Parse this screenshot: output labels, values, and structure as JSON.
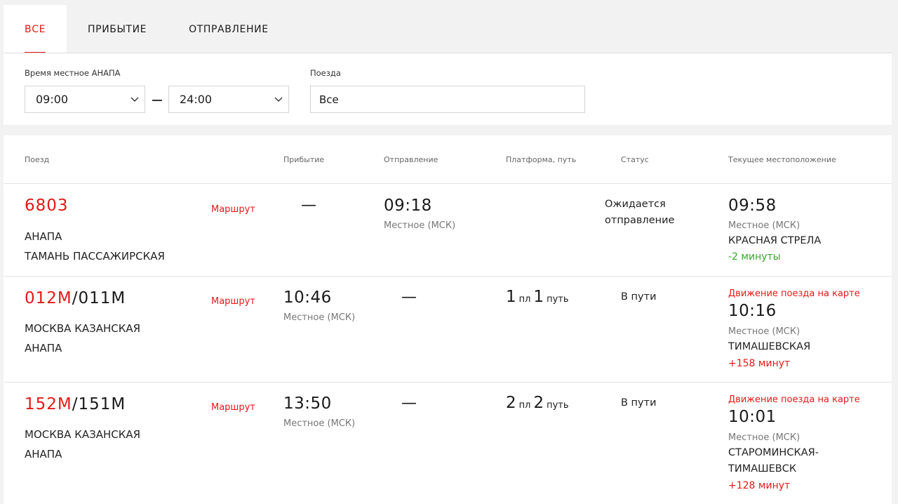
{
  "tabs": [
    {
      "label": "ВСЕ",
      "active": true
    },
    {
      "label": "ПРИБЫТИЕ",
      "active": false
    },
    {
      "label": "ОТПРАВЛЕНИЕ",
      "active": false
    }
  ],
  "filters": {
    "time_label": "Время местное АНАПА",
    "time_from": "09:00",
    "time_to": "24:00",
    "trains_label": "Поезда",
    "trains_value": "Все"
  },
  "table": {
    "headers": {
      "train": "Поезд",
      "arrival": "Прибытие",
      "departure": "Отправление",
      "platform": "Платформа, путь",
      "status": "Статус",
      "location": "Текущее местоположение"
    },
    "route_label": "Маршрут",
    "rows": [
      {
        "num_red": "6803",
        "num_dark": "",
        "from": "АНАПА",
        "to": "ТАМАНЬ ПАССАЖИРСКАЯ",
        "arrival": "—",
        "departure": "09:18",
        "departure_tz": "Местное (МСК)",
        "status_line1": "Ожидается",
        "status_line2": "отправление",
        "loc_time": "09:58",
        "loc_tz": "Местное (МСК)",
        "loc_name": "КРАСНАЯ СТРЕЛА",
        "delay": "-2 минуты",
        "delay_color": "#3aa82f"
      },
      {
        "num_red": "012М",
        "num_dark": "/011М",
        "from": "МОСКВА КАЗАНСКАЯ",
        "to": "АНАПА",
        "arrival": "10:46",
        "arrival_tz": "Местное (МСК)",
        "departure": "—",
        "platform_num": "1",
        "platform_label": "пл",
        "track_num": "1",
        "track_label": "путь",
        "status_line1": "В пути",
        "map_link": "Движение поезда на карте",
        "loc_time": "10:16",
        "loc_tz": "Местное (МСК)",
        "loc_name": "ТИМАШЕВСКАЯ",
        "delay": "+158 минут",
        "delay_color": "#e21a1a"
      },
      {
        "num_red": "152М",
        "num_dark": "/151М",
        "from": "МОСКВА КАЗАНСКАЯ",
        "to": "АНАПА",
        "arrival": "13:50",
        "arrival_tz": "Местное (МСК)",
        "departure": "—",
        "platform_num": "2",
        "platform_label": "пл",
        "track_num": "2",
        "track_label": "путь",
        "status_line1": "В пути",
        "map_link": "Движение поезда на карте",
        "loc_time": "10:01",
        "loc_tz": "Местное (МСК)",
        "loc_name_1": "СТАРОМИНСКАЯ-",
        "loc_name_2": "ТИМАШЕВСК",
        "delay": "+128 минут",
        "delay_color": "#e21a1a"
      }
    ]
  }
}
